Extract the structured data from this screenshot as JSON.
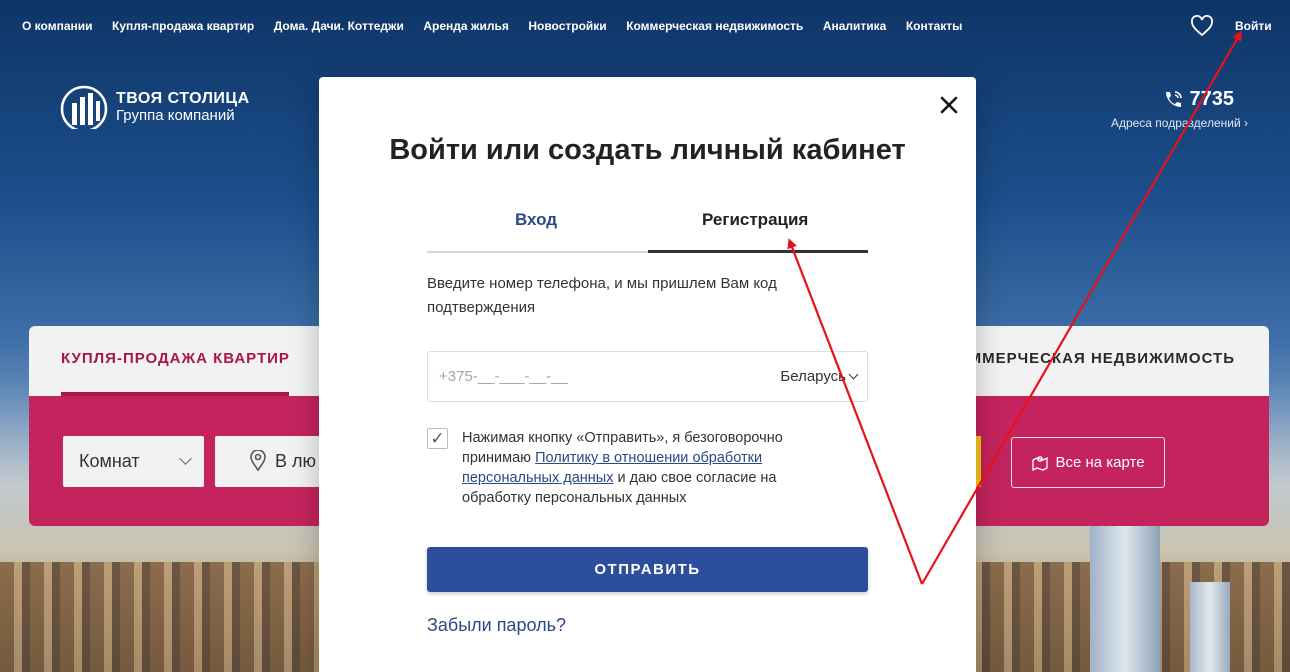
{
  "nav": {
    "items": [
      "О компании",
      "Купля-продажа квартир",
      "Дома. Дачи. Коттеджи",
      "Аренда жилья",
      "Новостройки",
      "Коммерческая недвижимость",
      "Аналитика",
      "Контакты"
    ],
    "login": "Войти"
  },
  "logo": {
    "line1": "ТВОЯ СТОЛИЦА",
    "line2": "Группа компаний"
  },
  "contact": {
    "phone": "7735",
    "addresses": "Адреса подразделений"
  },
  "search": {
    "tab_active": "КУПЛЯ-ПРОДАЖА КВАРТИР",
    "tab_other": "ММЕРЧЕСКАЯ НЕДВИЖИМОСТЬ",
    "rooms": "Комнат",
    "location": "В лю",
    "map": "Все на карте"
  },
  "modal": {
    "title": "Войти или создать личный кабинет",
    "tab_login": "Вход",
    "tab_register": "Регистрация",
    "hint": "Введите номер телефона, и мы пришлем Вам код подтверждения",
    "phone_placeholder": "+375-__-___-__-__",
    "country": "Беларусь",
    "checkbox_mark": "✓",
    "consent_before": "Нажимая кнопку «Отправить», я безоговорочно принимаю ",
    "consent_link": "Политику в отношении обработки персональных данных",
    "consent_after": " и даю свое согласие на обработку персональных данных",
    "submit": "ОТПРАВИТЬ",
    "forgot": "Забыли пароль?"
  },
  "colors": {
    "brand_blue": "#2d4e9c",
    "brand_crimson": "#c4245d",
    "annotation_red": "#e8101a"
  }
}
